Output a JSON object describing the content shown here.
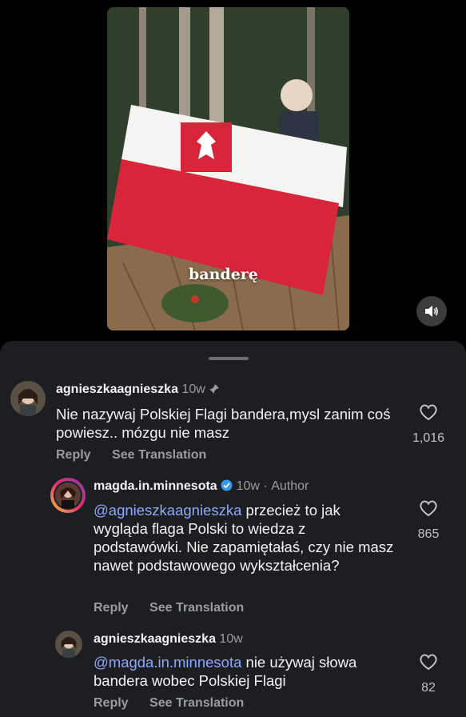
{
  "video": {
    "caption": "banderę"
  },
  "comments": [
    {
      "username": "agnieszkaagnieszka",
      "time": "10w",
      "text": "Nie nazywaj Polskiej Flagi bandera,mysl zanim coś powiesz.. mózgu nie masz",
      "likes": "1,016",
      "reply_label": "Reply",
      "translate_label": "See Translation"
    },
    {
      "username": "magda.in.minnesota",
      "time": "10w",
      "author_label": "Author",
      "mention": "@agnieszkaagnieszka",
      "text": " przecież to jak wygląda flaga Polski to wiedza z podstawówki. Nie zapamiętałaś, czy nie masz nawet podstawowego wykształcenia?",
      "likes": "865",
      "reply_label": "Reply",
      "translate_label": "See Translation"
    },
    {
      "username": "agnieszkaagnieszka",
      "time": "10w",
      "mention": "@magda.in.minnesota",
      "text": " nie używaj słowa bandera wobec Polskiej Flagi",
      "likes": "82",
      "reply_label": "Reply",
      "translate_label": "See Translation"
    }
  ],
  "colors": {
    "mention": "#8fa8ff",
    "sheet": "#1c1e22",
    "verified": "#3897f0"
  }
}
